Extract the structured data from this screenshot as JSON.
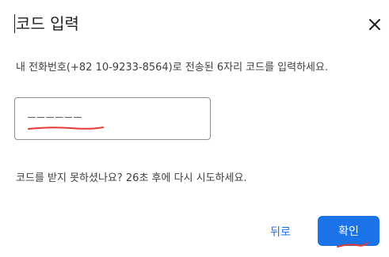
{
  "dialog": {
    "title": "코드 입력",
    "close_icon": "close-icon",
    "description": "내 전화번호(+82 10-9233-8564)로 전송된 6자리 코드를 입력하세요.",
    "code_input": {
      "placeholder": "––––––",
      "value": ""
    },
    "resend_text": "코드를 받지 못하셨나요? 26초 후에 다시 시도하세요.",
    "buttons": {
      "back_label": "뒤로",
      "confirm_label": "확인"
    }
  },
  "colors": {
    "accent": "#1a73e8",
    "annotation": "#e53935"
  }
}
